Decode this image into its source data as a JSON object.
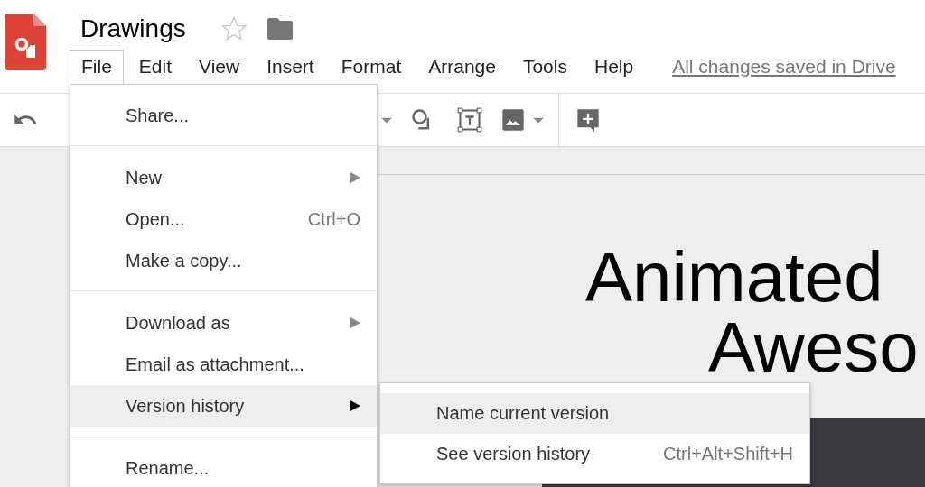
{
  "document": {
    "title": "Drawings",
    "starred": false
  },
  "menu_bar": [
    {
      "label": "File",
      "selected": true
    },
    {
      "label": "Edit",
      "selected": false
    },
    {
      "label": "View",
      "selected": false
    },
    {
      "label": "Insert",
      "selected": false
    },
    {
      "label": "Format",
      "selected": false
    },
    {
      "label": "Arrange",
      "selected": false
    },
    {
      "label": "Tools",
      "selected": false
    },
    {
      "label": "Help",
      "selected": false
    }
  ],
  "save_status": "All changes saved in Drive",
  "file_menu": [
    {
      "kind": "item",
      "label": "Share...",
      "selected": false
    },
    {
      "kind": "separator"
    },
    {
      "kind": "item",
      "label": "New",
      "submenu": true,
      "selected": false
    },
    {
      "kind": "item",
      "label": "Open...",
      "shortcut": "Ctrl+O",
      "selected": false
    },
    {
      "kind": "item",
      "label": "Make a copy...",
      "selected": false
    },
    {
      "kind": "separator"
    },
    {
      "kind": "item",
      "label": "Download as",
      "submenu": true,
      "selected": false
    },
    {
      "kind": "item",
      "label": "Email as attachment...",
      "selected": false
    },
    {
      "kind": "item",
      "label": "Version history",
      "submenu": true,
      "selected": true
    },
    {
      "kind": "separator"
    },
    {
      "kind": "item",
      "label": "Rename...",
      "selected": false
    }
  ],
  "submenu": [
    {
      "label": "Name current version",
      "selected": true
    },
    {
      "label": "See version history",
      "shortcut": "Ctrl+Alt+Shift+H",
      "selected": false
    }
  ],
  "slide": {
    "title_lines": [
      "Animated",
      "Aweso"
    ]
  }
}
